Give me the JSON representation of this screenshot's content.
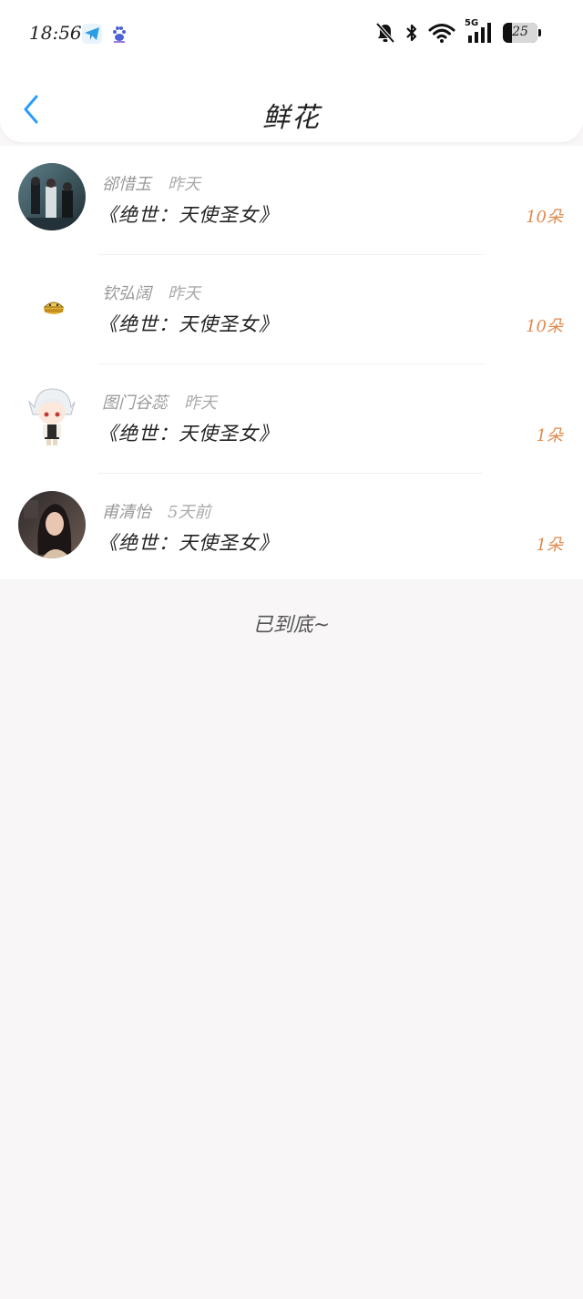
{
  "status_bar": {
    "time": "18:56",
    "apps": [
      "telegram-icon",
      "baidu-paw-icon"
    ],
    "signal_label": "5G",
    "battery_level": "25",
    "battery_fraction": 0.25,
    "icons": [
      "bell-muted-icon",
      "bluetooth-icon",
      "wifi-icon",
      "signal-icon",
      "battery-icon"
    ]
  },
  "nav": {
    "back_icon": "chevron-left-icon",
    "title": "鲜花",
    "accent_color": "#2a9cff"
  },
  "list": {
    "count_color": "#e08a4c",
    "items": [
      {
        "user": "郤惜玉",
        "time": "昨天",
        "book": "《绝世：天使圣女》",
        "count": "10朵",
        "avatar": "group-photo-avatar"
      },
      {
        "user": "钦弘阔",
        "time": "昨天",
        "book": "《绝世：天使圣女》",
        "count": "10朵",
        "avatar": "cartoon-avatar"
      },
      {
        "user": "图门谷蕊",
        "time": "昨天",
        "book": "《绝世：天使圣女》",
        "count": "1朵",
        "avatar": "anime-white-hair-avatar"
      },
      {
        "user": "甫清怡",
        "time": "5天前",
        "book": "《绝世：天使圣女》",
        "count": "1朵",
        "avatar": "woman-photo-avatar"
      }
    ]
  },
  "footer": {
    "end_text": "已到底~"
  }
}
